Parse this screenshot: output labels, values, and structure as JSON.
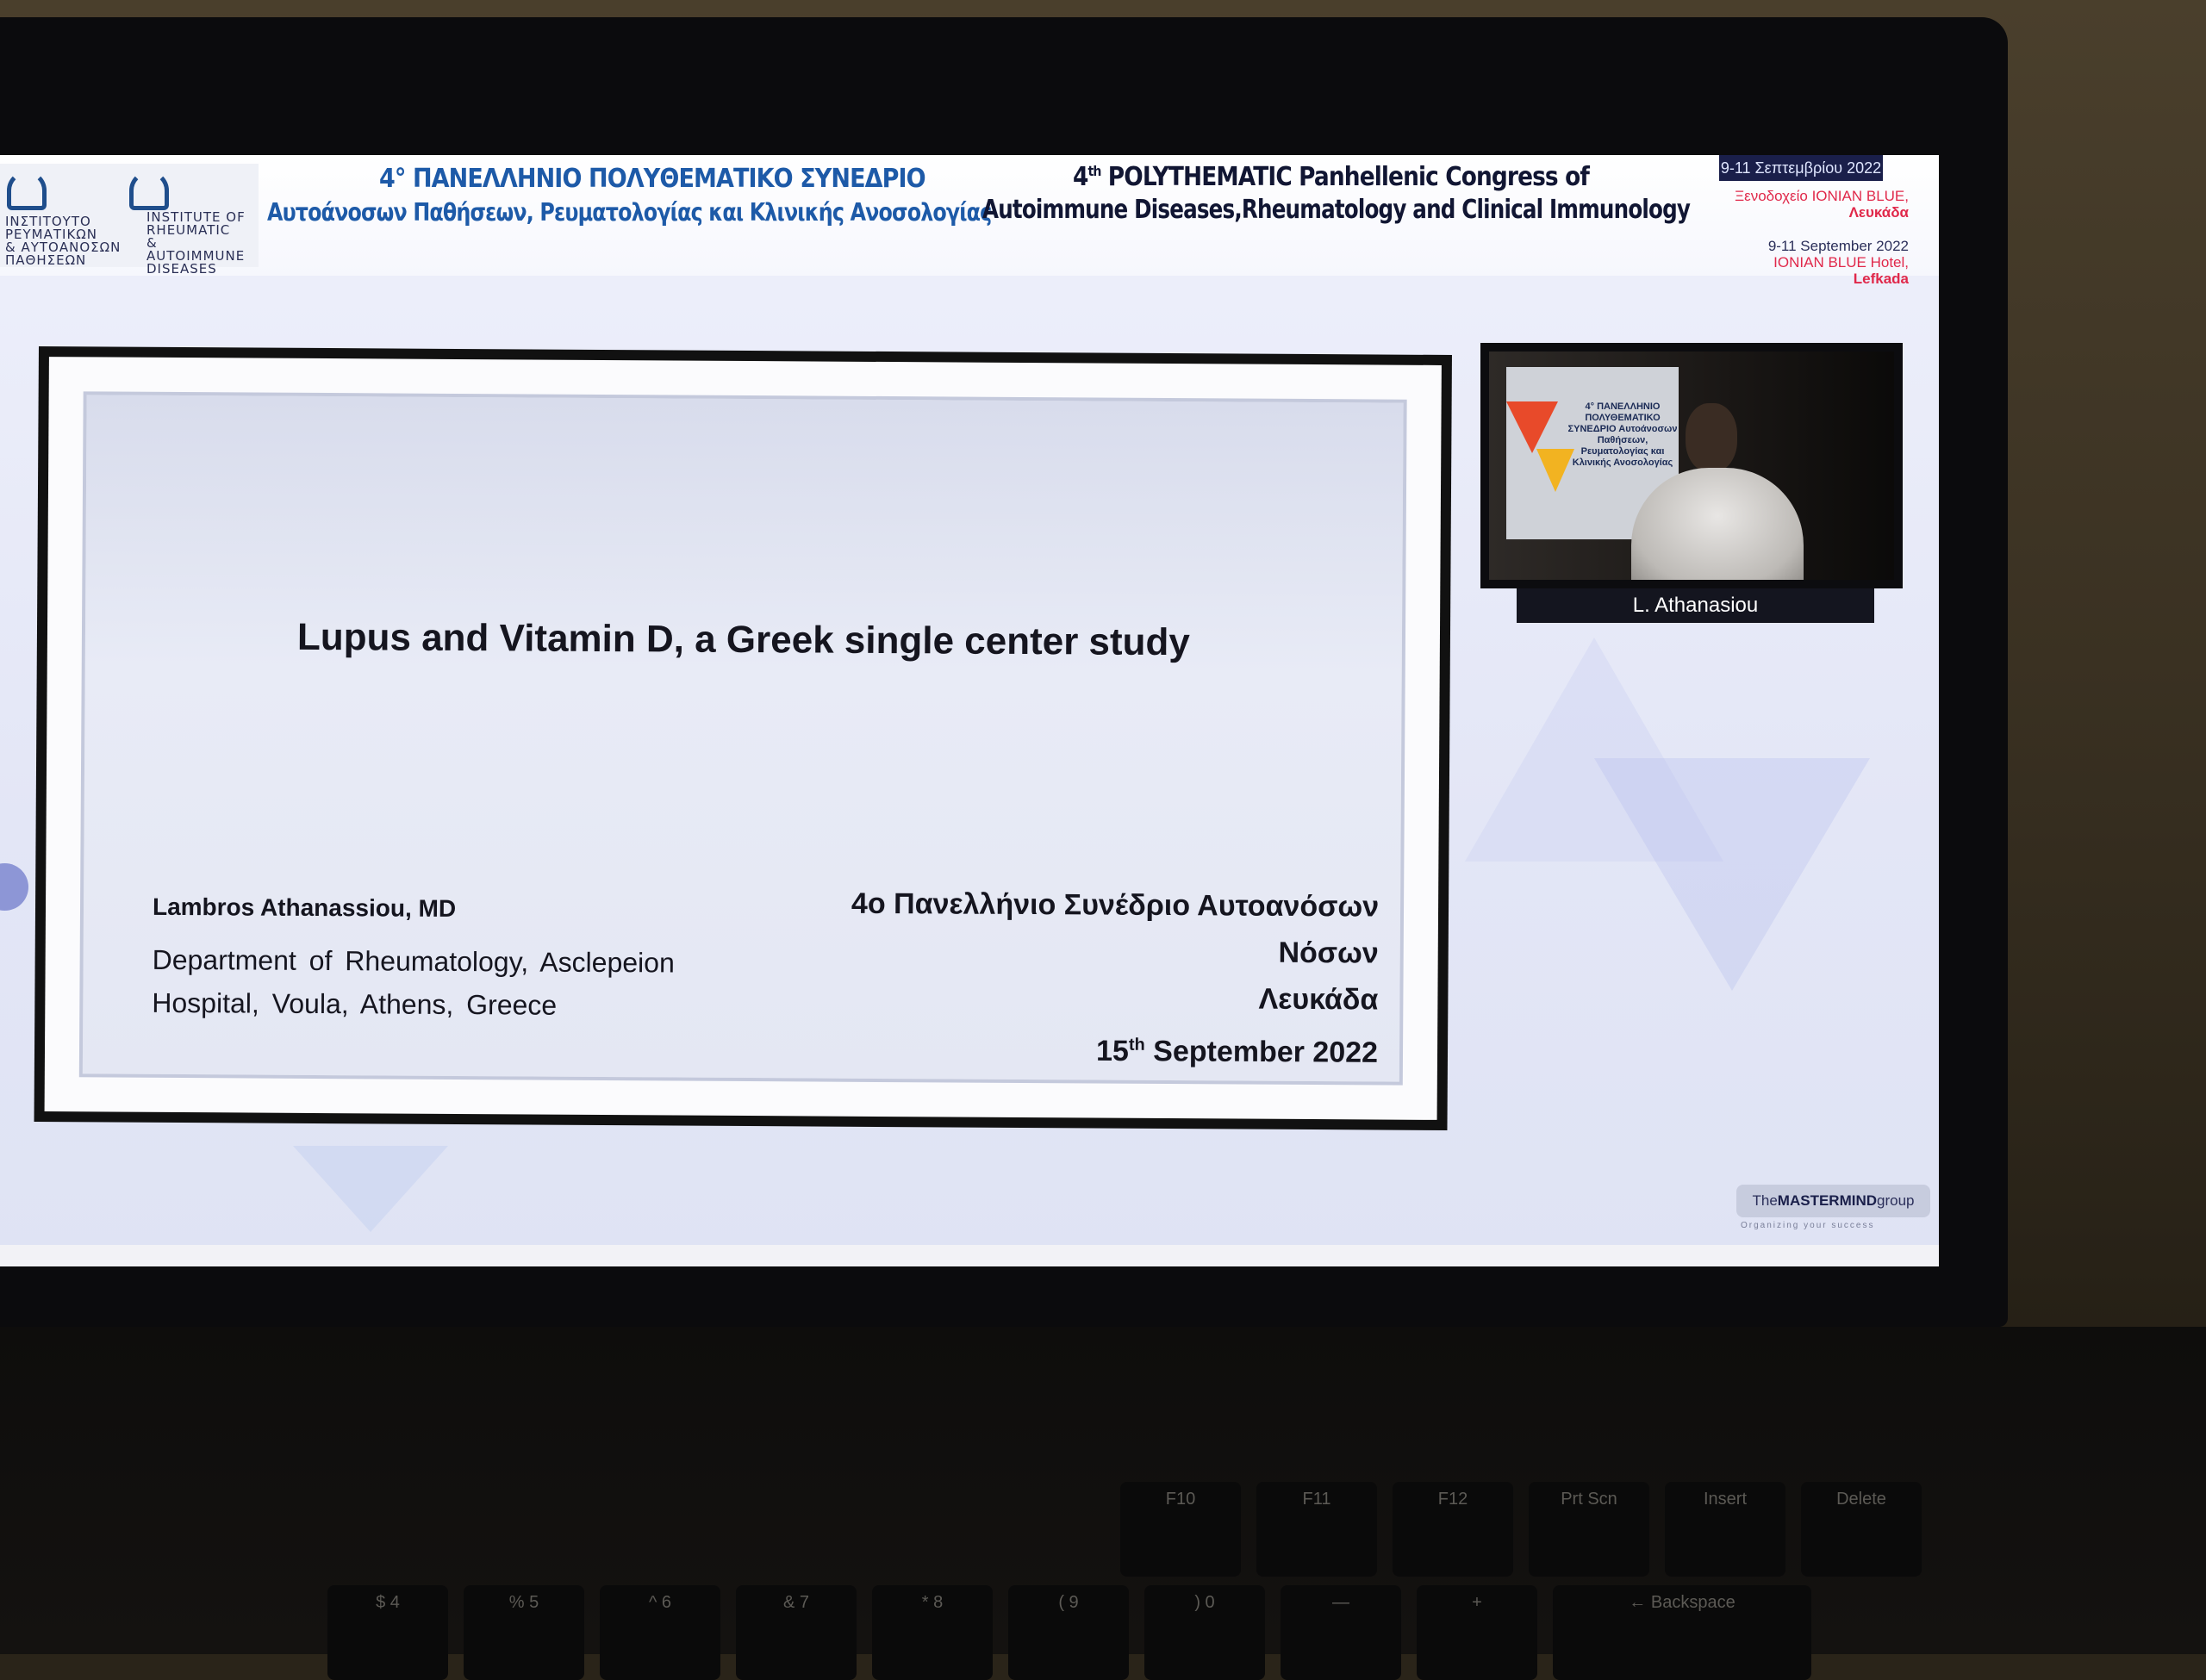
{
  "header": {
    "greek_title_line1": "4° ΠΑΝΕΛΛΗΝΙΟ ΠΟΛΥΘΕΜΑΤΙΚΟ ΣΥΝΕΔΡΙΟ",
    "greek_title_line2": "Αυτοάνοσων Παθήσεων, Ρευματολογίας και Κλινικής Ανοσολογίας",
    "english_title_prefix": "4",
    "english_title_sup": "th",
    "english_title_line1_rest": " POLYTHEMATIC Panhellenic Congress of",
    "english_title_line2": "Autoimmune Diseases,Rheumatology and Clinical Immunology",
    "logo_gr": "ΙΝΣΤΙΤΟΥΤΟ\nΡΕΥΜΑΤΙΚΩΝ\n& ΑΥΤΟΑΝΟΣΩΝ\nΠΑΘΗΣΕΩΝ",
    "logo_en": "INSTITUTE OF\nRHEUMATIC\n& AUTOIMMUNE\nDISEASES",
    "date_tab": "9-11 Σεπτεμβρίου 2022",
    "venue_gr_line1": "Ξενοδοχείο IONIAN BLUE,",
    "venue_gr_line2": "Λευκάδα",
    "venue_en_line1": "9-11 September 2022",
    "venue_en_line2": "IONIAN BLUE Hotel,",
    "venue_en_line3": "Lefkada"
  },
  "slide": {
    "title": "Lupus and Vitamin D, a Greek single center study",
    "author": "Lambros Athanassiou, MD",
    "department": "Department of Rheumatology, Asclepeion Hospital, Voula, Athens, Greece",
    "conf_line1": "4ο Πανελλήνιο Συνέδριο Αυτοανόσων",
    "conf_line2": "Νόσων",
    "conf_line3": "Λευκάδα",
    "conf_date_day": "15",
    "conf_date_sup": "th",
    "conf_date_rest": " September 2022"
  },
  "video": {
    "speaker_name": "L. Athanasiou",
    "banner_text": "4° ΠΑΝΕΛΛΗΝΙΟ ΠΟΛΥΘΕΜΑΤΙΚΟ ΣΥΝΕΔΡΙΟ Αυτοάνοσων Παθήσεων, Ρευματολογίας και Κλινικής Ανοσολογίας"
  },
  "branding": {
    "mastermind_prefix": "The",
    "mastermind_name": "MASTERMIND",
    "mastermind_suffix": "group",
    "mastermind_tagline": "Organizing your success"
  },
  "keyboard": {
    "row1": [
      "F10",
      "F11",
      "F12",
      "Prt Scn",
      "Insert",
      "Delete"
    ],
    "row2": [
      "$ 4",
      "% 5",
      "^ 6",
      "& 7",
      "* 8",
      "( 9",
      ") 0",
      "—",
      "+",
      "← Backspace"
    ]
  },
  "colors": {
    "greek_header": "#1d5aa8",
    "english_header": "#111633",
    "venue_accent": "#e0284a",
    "bezel": "#0b0b0d"
  }
}
